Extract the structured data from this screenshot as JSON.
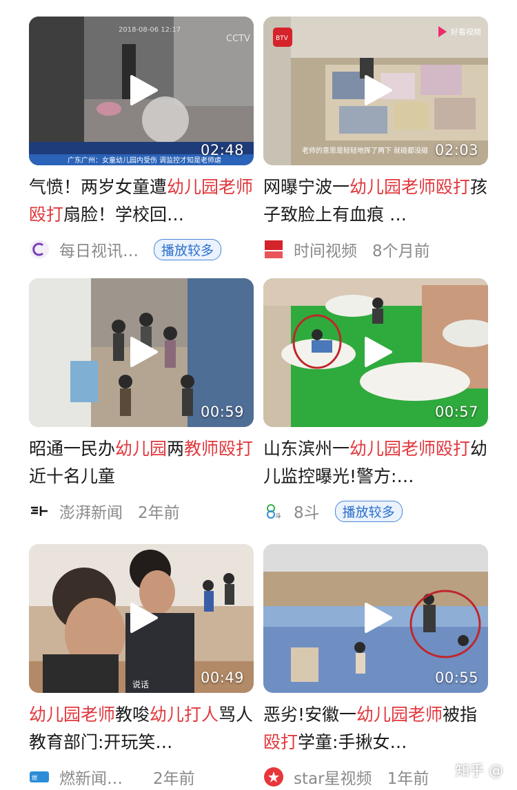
{
  "videos": [
    {
      "title_parts": [
        {
          "text": "气愤！两岁女童遭",
          "hl": false
        },
        {
          "text": "幼儿园老师殴打",
          "hl": true
        },
        {
          "text": "扇脸！学校回…",
          "hl": false
        }
      ],
      "duration": "02:48",
      "source": "每日视讯…",
      "time": "",
      "badge": "播放较多",
      "overlay_timestamp": "2018-08-06 12:17",
      "overlay_caption": "广东广州：女童幼儿园内受伤  调监控才知是老师虐"
    },
    {
      "title_parts": [
        {
          "text": "网曝宁波一",
          "hl": false
        },
        {
          "text": "幼儿园老师殴打",
          "hl": true
        },
        {
          "text": "孩子致脸上有血痕 …",
          "hl": false
        }
      ],
      "duration": "02:03",
      "source": "时间视频",
      "time": "8个月前",
      "badge": "",
      "overlay_caption": "老师的意思是轻轻地挥了两下 就碰都没碰",
      "overlay_logo": "好看视频"
    },
    {
      "title_parts": [
        {
          "text": "昭通一民办",
          "hl": false
        },
        {
          "text": "幼儿园",
          "hl": true
        },
        {
          "text": "两",
          "hl": false
        },
        {
          "text": "教师殴打",
          "hl": true
        },
        {
          "text": "近十名儿童",
          "hl": false
        }
      ],
      "duration": "00:59",
      "source": "澎湃新闻",
      "time": "2年前",
      "badge": ""
    },
    {
      "title_parts": [
        {
          "text": "山东滨州一",
          "hl": false
        },
        {
          "text": "幼儿园老师殴打",
          "hl": true
        },
        {
          "text": "幼儿监控曝光!警方:…",
          "hl": false
        }
      ],
      "duration": "00:57",
      "source": "8斗",
      "time": "",
      "badge": "播放较多"
    },
    {
      "title_parts": [
        {
          "text": "幼儿园老师",
          "hl": true
        },
        {
          "text": "教唆",
          "hl": false
        },
        {
          "text": "幼儿打人",
          "hl": true
        },
        {
          "text": "骂人 教育部门:开玩笑…",
          "hl": false
        }
      ],
      "duration": "00:49",
      "source": "燃新闻…",
      "time": "2年前",
      "badge": "",
      "overlay_caption": "说话"
    },
    {
      "title_parts": [
        {
          "text": "恶劣!安徽一",
          "hl": false
        },
        {
          "text": "幼儿园老师",
          "hl": true
        },
        {
          "text": "被指",
          "hl": false
        },
        {
          "text": "殴打",
          "hl": true
        },
        {
          "text": "学童:手揪女…",
          "hl": false
        }
      ],
      "duration": "00:55",
      "source": "star星视频",
      "time": "1年前",
      "badge": ""
    }
  ],
  "watermark": "知乎 @",
  "colors": {
    "highlight": "#e0383e",
    "badge": "#2c6fcc",
    "meta": "#8a8a8a"
  }
}
